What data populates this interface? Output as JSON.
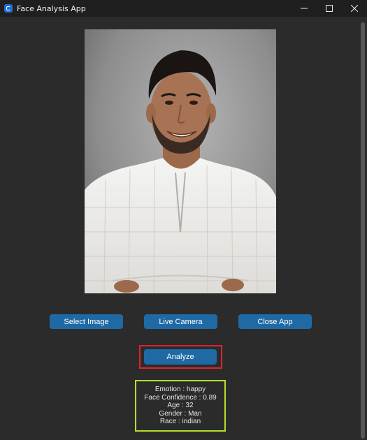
{
  "window": {
    "title": "Face Analysis App",
    "icon": "app-icon",
    "controls": [
      "minimize-icon",
      "maximize-icon",
      "close-icon"
    ]
  },
  "image": {
    "description_icon": "portrait-photo"
  },
  "buttons": {
    "select_image": "Select Image",
    "live_camera": "Live Camera",
    "close_app": "Close App",
    "analyze": "Analyze"
  },
  "results": {
    "emotion": "Emotion : happy",
    "face_confidence": "Face Confidence : 0.89",
    "age": "Age : 32",
    "gender": "Gender : Man",
    "race": "Race : indian"
  },
  "colors": {
    "background": "#2b2b2b",
    "button": "#1f6aa5",
    "analyze_highlight": "#e0242a",
    "results_highlight": "#b5e02a"
  }
}
